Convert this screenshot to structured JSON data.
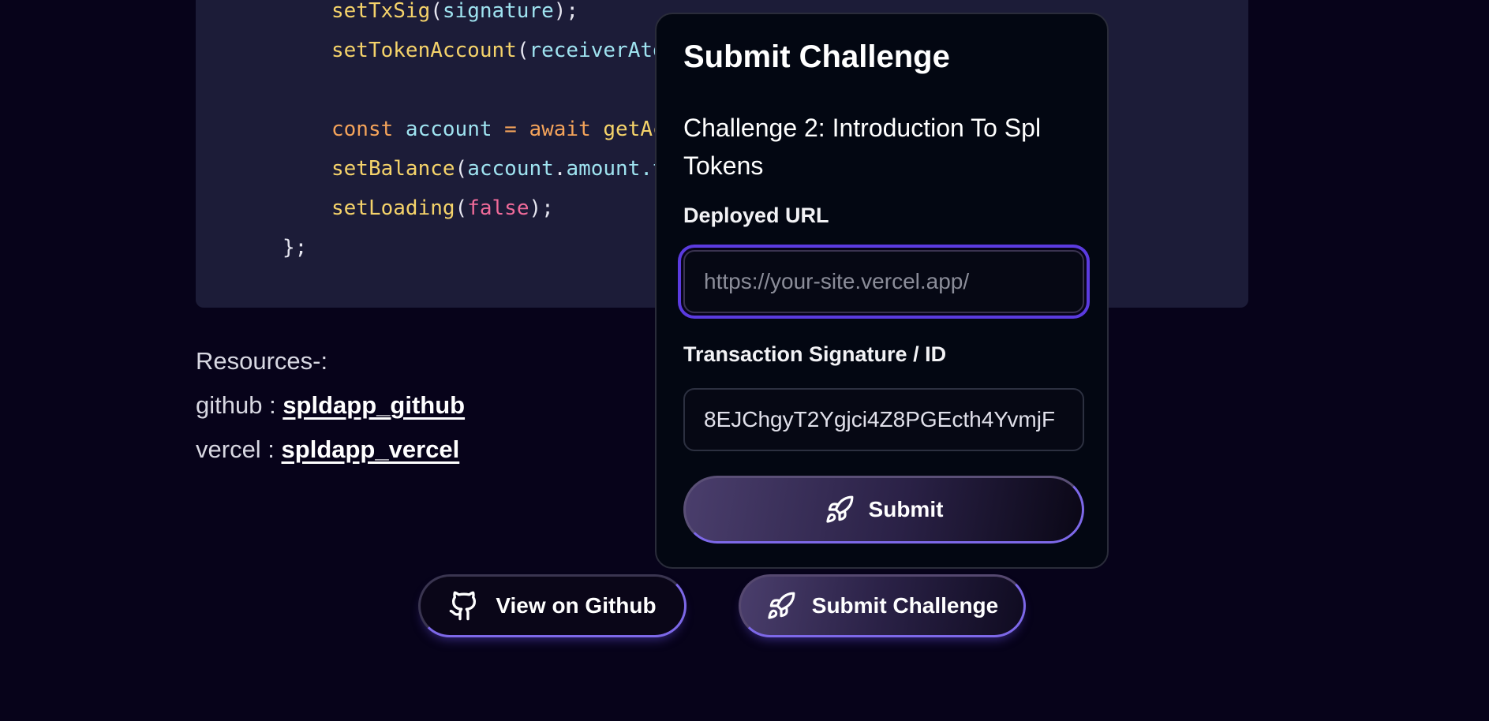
{
  "code": {
    "lines": [
      {
        "indent": "    ",
        "tokens": [
          [
            "setTxSig",
            "fn"
          ],
          [
            "(",
            "punc"
          ],
          [
            "signature",
            "var"
          ],
          [
            ");",
            "punc"
          ]
        ]
      },
      {
        "indent": "    ",
        "tokens": [
          [
            "setTokenAccount",
            "fn"
          ],
          [
            "(",
            "punc"
          ],
          [
            "receiverAto",
            "var"
          ]
        ]
      },
      {
        "indent": "",
        "tokens": []
      },
      {
        "indent": "    ",
        "tokens": [
          [
            "const ",
            "kw"
          ],
          [
            "account ",
            "var"
          ],
          [
            "= ",
            "kw"
          ],
          [
            "await ",
            "kw"
          ],
          [
            "getAc",
            "fn"
          ]
        ]
      },
      {
        "indent": "    ",
        "tokens": [
          [
            "setBalance",
            "fn"
          ],
          [
            "(",
            "punc"
          ],
          [
            "account",
            "var"
          ],
          [
            ".",
            "punc"
          ],
          [
            "amount",
            "var"
          ],
          [
            ".t",
            "var"
          ]
        ]
      },
      {
        "indent": "    ",
        "tokens": [
          [
            "setLoading",
            "fn"
          ],
          [
            "(",
            "punc"
          ],
          [
            "false",
            "bool"
          ],
          [
            ");",
            "punc"
          ]
        ]
      },
      {
        "indent": "",
        "tokens": [
          [
            "};",
            "punc"
          ]
        ]
      }
    ]
  },
  "resources": {
    "heading": "Resources-:",
    "github_prefix": "github : ",
    "github_link": "spldapp_github",
    "vercel_prefix": "vercel : ",
    "vercel_link": "spldapp_vercel"
  },
  "buttons": {
    "github_label": "View on Github",
    "submit_challenge_label": "Submit Challenge"
  },
  "modal": {
    "title": "Submit Challenge",
    "subtitle": "Challenge 2: Introduction To Spl Tokens",
    "deployed_url_label": "Deployed URL",
    "deployed_url_placeholder": "https://your-site.vercel.app/",
    "deployed_url_value": "",
    "tx_label": "Transaction Signature / ID",
    "tx_value": "8EJChgyT2Ygjci4Z8PGEcth4YvmjF",
    "submit_label": "Submit"
  },
  "icons": {
    "github": "github-icon",
    "rocket": "rocket-icon"
  },
  "colors": {
    "background": "#07031a",
    "accent": "#7d68e8",
    "focus_ring": "#5b3be0",
    "code_bg": "#1c1c38"
  }
}
